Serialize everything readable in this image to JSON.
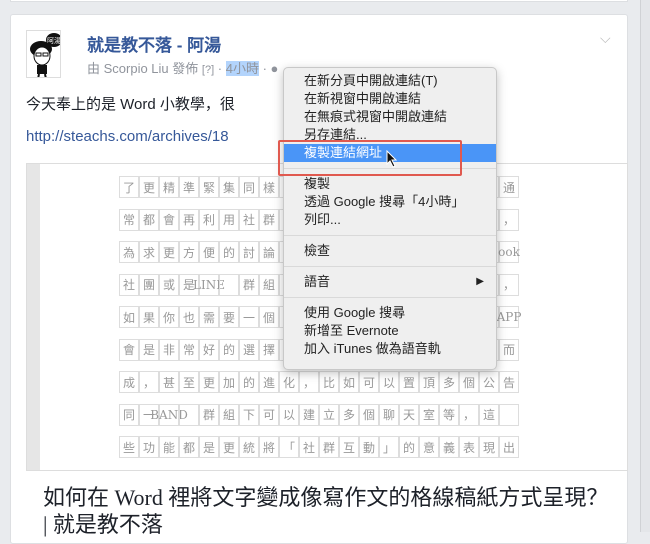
{
  "post": {
    "page_name": "就是教不落 - 阿湯",
    "posted_by": "由 Scorpio Liu 發佈",
    "help": "[?]",
    "separator": "·",
    "time": "4小時",
    "body": "今天奉上的是 Word 小教學，很",
    "link": "http://steachs.com/archives/18",
    "link_title": "如何在 Word 裡將文字變成像寫作文的格線稿紙方式呈現？ | 就是教不落",
    "avatar_badge": "阿湯"
  },
  "preview_grid": [
    [
      "了",
      "更",
      "精",
      "準",
      "緊",
      "集",
      "同",
      "樣",
      "",
      "",
      "",
      "",
      "",
      "",
      "",
      "",
      "",
      "",
      "",
      "通"
    ],
    [
      "常",
      "都",
      "會",
      "再",
      "利",
      "用",
      "社",
      "群",
      "",
      "",
      "",
      "",
      "",
      "",
      "",
      "",
      "",
      "",
      "",
      "，"
    ],
    [
      "為",
      "求",
      "更",
      "方",
      "便",
      "的",
      "討",
      "論",
      "",
      "",
      "",
      "",
      "",
      "",
      "",
      "",
      "",
      "",
      "",
      "ook"
    ],
    [
      "社",
      "團",
      "或",
      "是",
      "LINE",
      "",
      "群",
      "組",
      "",
      "",
      "",
      "",
      "",
      "",
      "",
      "",
      "",
      "",
      "",
      "，"
    ],
    [
      "如",
      "果",
      "你",
      "也",
      "需",
      "要",
      "一",
      "個",
      "",
      "",
      "",
      "",
      "",
      "",
      "",
      "",
      "",
      "",
      "",
      "APP"
    ],
    [
      "會",
      "是",
      "非",
      "常",
      "好",
      "的",
      "選",
      "擇",
      "",
      "",
      "",
      "",
      "",
      "",
      "",
      "",
      "",
      "",
      "",
      "而"
    ],
    [
      "成",
      "，",
      "甚",
      "至",
      "更",
      "加",
      "的",
      "進",
      "化",
      "，",
      "比",
      "如",
      "可",
      "以",
      "置",
      "頂",
      "多",
      "個",
      "公",
      "告"
    ],
    [
      "同",
      "一",
      "BAND",
      "",
      "群",
      "組",
      "下",
      "可",
      "以",
      "建",
      "立",
      "多",
      "個",
      "聊",
      "天",
      "室",
      "等",
      "，",
      "這",
      ""
    ],
    [
      "些",
      "功",
      "能",
      "都",
      "是",
      "更",
      "統",
      "將",
      "「",
      "社",
      "群",
      "互",
      "動",
      "」",
      "的",
      "意",
      "義",
      "表",
      "現",
      "出"
    ]
  ],
  "context_menu": {
    "groups": [
      [
        "在新分頁中開啟連結(T)",
        "在新視窗中開啟連結",
        "在無痕式視窗中開啟連結",
        "另存連結...",
        "複製連結網址"
      ],
      [
        "複製",
        "透過 Google 搜尋「4小時」",
        "列印..."
      ],
      [
        "檢查"
      ],
      [
        "語音"
      ],
      [
        "使用 Google 搜尋",
        "新增至 Evernote",
        "加入 iTunes 做為語音軌"
      ]
    ],
    "highlighted": "複製連結網址",
    "submenu_arrow": "▶"
  },
  "colors": {
    "accent": "#365899",
    "highlight": "#4a95f7",
    "annotation": "#e0594f"
  }
}
